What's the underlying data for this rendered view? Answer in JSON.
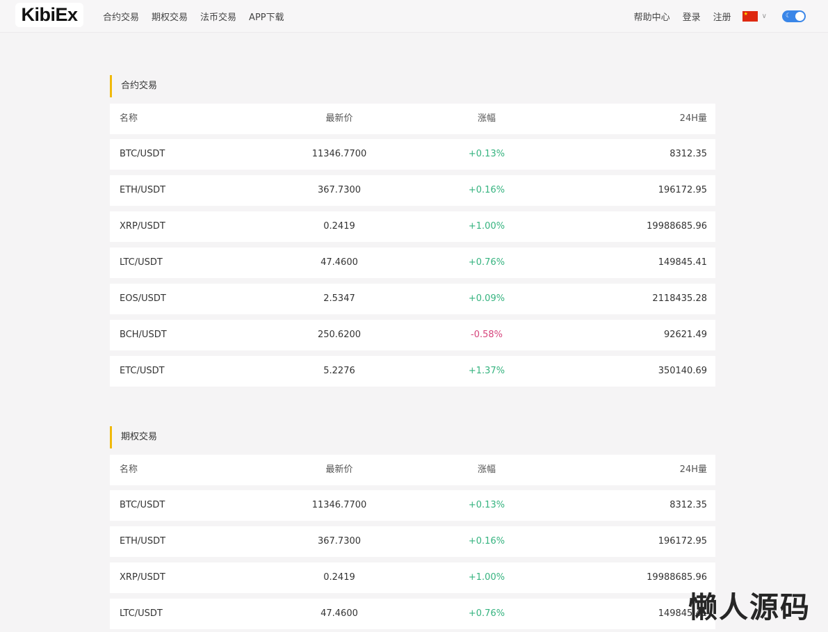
{
  "header": {
    "logo": "KibiEx",
    "nav": [
      "合约交易",
      "期权交易",
      "法币交易",
      "APP下载"
    ],
    "help": "帮助中心",
    "login": "登录",
    "register": "注册",
    "language_icon": "china-flag-icon",
    "theme_toggle": "on"
  },
  "sections": [
    {
      "title": "合约交易",
      "columns": {
        "name": "名称",
        "price": "最新价",
        "change": "涨幅",
        "volume": "24H量"
      },
      "rows": [
        {
          "name": "BTC/USDT",
          "price": "11346.7700",
          "change": "+0.13%",
          "volume": "8312.35",
          "direction": "up"
        },
        {
          "name": "ETH/USDT",
          "price": "367.7300",
          "change": "+0.16%",
          "volume": "196172.95",
          "direction": "up"
        },
        {
          "name": "XRP/USDT",
          "price": "0.2419",
          "change": "+1.00%",
          "volume": "19988685.96",
          "direction": "up"
        },
        {
          "name": "LTC/USDT",
          "price": "47.4600",
          "change": "+0.76%",
          "volume": "149845.41",
          "direction": "up"
        },
        {
          "name": "EOS/USDT",
          "price": "2.5347",
          "change": "+0.09%",
          "volume": "2118435.28",
          "direction": "up"
        },
        {
          "name": "BCH/USDT",
          "price": "250.6200",
          "change": "-0.58%",
          "volume": "92621.49",
          "direction": "down"
        },
        {
          "name": "ETC/USDT",
          "price": "5.2276",
          "change": "+1.37%",
          "volume": "350140.69",
          "direction": "up"
        }
      ]
    },
    {
      "title": "期权交易",
      "columns": {
        "name": "名称",
        "price": "最新价",
        "change": "涨幅",
        "volume": "24H量"
      },
      "rows": [
        {
          "name": "BTC/USDT",
          "price": "11346.7700",
          "change": "+0.13%",
          "volume": "8312.35",
          "direction": "up"
        },
        {
          "name": "ETH/USDT",
          "price": "367.7300",
          "change": "+0.16%",
          "volume": "196172.95",
          "direction": "up"
        },
        {
          "name": "XRP/USDT",
          "price": "0.2419",
          "change": "+1.00%",
          "volume": "19988685.96",
          "direction": "up"
        },
        {
          "name": "LTC/USDT",
          "price": "47.4600",
          "change": "+0.76%",
          "volume": "149845.41",
          "direction": "up"
        }
      ]
    }
  ],
  "colors": {
    "accent": "#f0b90b",
    "up": "#35b37f",
    "down": "#d6457c",
    "toggle": "#3a86e8"
  },
  "watermark": "懒人源码"
}
